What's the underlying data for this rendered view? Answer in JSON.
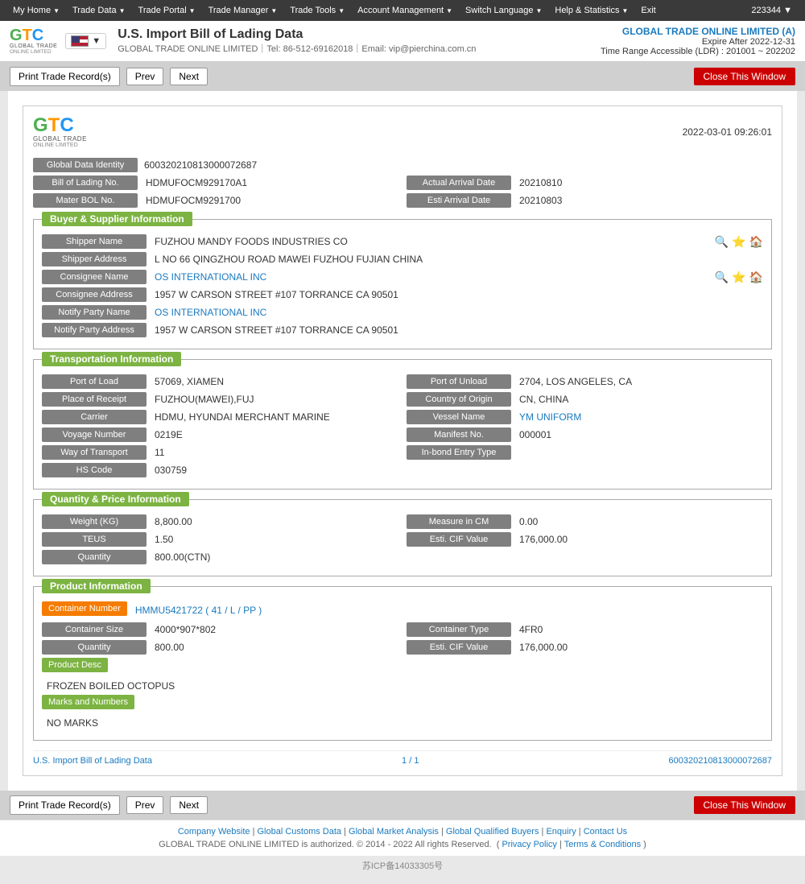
{
  "topnav": {
    "items": [
      {
        "label": "My Home",
        "id": "my-home"
      },
      {
        "label": "Trade Data",
        "id": "trade-data"
      },
      {
        "label": "Trade Portal",
        "id": "trade-portal"
      },
      {
        "label": "Trade Manager",
        "id": "trade-manager"
      },
      {
        "label": "Trade Tools",
        "id": "trade-tools"
      },
      {
        "label": "Account Management",
        "id": "account-management"
      },
      {
        "label": "Switch Language",
        "id": "switch-language"
      },
      {
        "label": "Help & Statistics",
        "id": "help-statistics"
      },
      {
        "label": "Exit",
        "id": "exit"
      }
    ],
    "user_id": "223344 ▼"
  },
  "header": {
    "title": "U.S. Import Bill of Lading Data",
    "subtitle": "GLOBAL TRADE ONLINE LIMITED｜Tel: 86-512-69162018｜Email: vip@pierchina.com.cn",
    "company": "GLOBAL TRADE ONLINE LIMITED (A)",
    "expire": "Expire After 2022-12-31",
    "range": "Time Range Accessible (LDR) : 201001 ~ 202202",
    "logo_letters": {
      "g": "G",
      "t": "T",
      "c": "C"
    },
    "logo_sub": "GLOBAL TRADE",
    "logo_tagline": "ONLINE LIMITED"
  },
  "toolbar": {
    "print_label": "Print Trade Record(s)",
    "prev_label": "Prev",
    "next_label": "Next",
    "close_label": "Close This Window"
  },
  "record": {
    "date": "2022-03-01 09:26:01",
    "global_data_identity_label": "Global Data Identity",
    "global_data_identity_value": "600320210813000072687",
    "bill_of_lading_label": "Bill of Lading No.",
    "bill_of_lading_value": "HDMUFOCM929170A1",
    "actual_arrival_label": "Actual Arrival Date",
    "actual_arrival_value": "20210810",
    "mater_bol_label": "Mater BOL No.",
    "mater_bol_value": "HDMUFOCM9291700",
    "esti_arrival_label": "Esti Arrival Date",
    "esti_arrival_value": "20210803",
    "sections": {
      "buyer_supplier": {
        "title": "Buyer & Supplier Information",
        "fields": [
          {
            "label": "Shipper Name",
            "value": "FUZHOU MANDY FOODS INDUSTRIES CO",
            "icons": [
              "search",
              "star",
              "home"
            ]
          },
          {
            "label": "Shipper Address",
            "value": "L NO 66 QINGZHOU ROAD MAWEI FUZHOU FUJIAN CHINA"
          },
          {
            "label": "Consignee Name",
            "value": "OS INTERNATIONAL INC",
            "icons": [
              "search",
              "star",
              "home"
            ]
          },
          {
            "label": "Consignee Address",
            "value": "1957 W CARSON STREET #107 TORRANCE CA 90501"
          },
          {
            "label": "Notify Party Name",
            "value": "OS INTERNATIONAL INC"
          },
          {
            "label": "Notify Party Address",
            "value": "1957 W CARSON STREET #107 TORRANCE CA 90501"
          }
        ]
      },
      "transportation": {
        "title": "Transportation Information",
        "rows": [
          {
            "left_label": "Port of Load",
            "left_value": "57069, XIAMEN",
            "right_label": "Port of Unload",
            "right_value": "2704, LOS ANGELES, CA"
          },
          {
            "left_label": "Place of Receipt",
            "left_value": "FUZHOU(MAWEI),FUJ",
            "right_label": "Country of Origin",
            "right_value": "CN, CHINA"
          },
          {
            "left_label": "Carrier",
            "left_value": "HDMU, HYUNDAI MERCHANT MARINE",
            "right_label": "Vessel Name",
            "right_value": "YM UNIFORM"
          },
          {
            "left_label": "Voyage Number",
            "left_value": "0219E",
            "right_label": "Manifest No.",
            "right_value": "000001"
          },
          {
            "left_label": "Way of Transport",
            "left_value": "11",
            "right_label": "In-bond Entry Type",
            "right_value": ""
          },
          {
            "left_label": "HS Code",
            "left_value": "030759",
            "right_label": "",
            "right_value": ""
          }
        ]
      },
      "quantity_price": {
        "title": "Quantity & Price Information",
        "rows": [
          {
            "left_label": "Weight (KG)",
            "left_value": "8,800.00",
            "right_label": "Measure in CM",
            "right_value": "0.00"
          },
          {
            "left_label": "TEUS",
            "left_value": "1.50",
            "right_label": "Esti. CIF Value",
            "right_value": "176,000.00"
          },
          {
            "left_label": "Quantity",
            "left_value": "800.00(CTN)",
            "right_label": "",
            "right_value": ""
          }
        ]
      },
      "product": {
        "title": "Product Information",
        "container_number_label": "Container Number",
        "container_number_value": "HMMU5421722 ( 41 / L / PP )",
        "rows": [
          {
            "left_label": "Container Size",
            "left_value": "4000*907*802",
            "right_label": "Container Type",
            "right_value": "4FR0"
          },
          {
            "left_label": "Quantity",
            "left_value": "800.00",
            "right_label": "Esti. CIF Value",
            "right_value": "176,000.00"
          }
        ],
        "product_desc_label": "Product Desc",
        "product_desc_value": "FROZEN BOILED OCTOPUS",
        "marks_label": "Marks and Numbers",
        "marks_value": "NO MARKS"
      }
    },
    "footer": {
      "left": "U.S. Import Bill of Lading Data",
      "middle": "1 / 1",
      "right": "600320210813000072687"
    }
  },
  "footer": {
    "links": [
      {
        "label": "Company Website",
        "sep": "|"
      },
      {
        "label": "Global Customs Data",
        "sep": "|"
      },
      {
        "label": "Global Market Analysis",
        "sep": "|"
      },
      {
        "label": "Global Qualified Buyers",
        "sep": "|"
      },
      {
        "label": "Enquiry",
        "sep": "|"
      },
      {
        "label": "Contact Us",
        "sep": ""
      }
    ],
    "copyright": "GLOBAL TRADE ONLINE LIMITED is authorized. © 2014 - 2022 All rights Reserved.",
    "privacy": "Privacy Policy",
    "terms": "Terms & Conditions",
    "icp": "苏ICP备14033305号"
  }
}
